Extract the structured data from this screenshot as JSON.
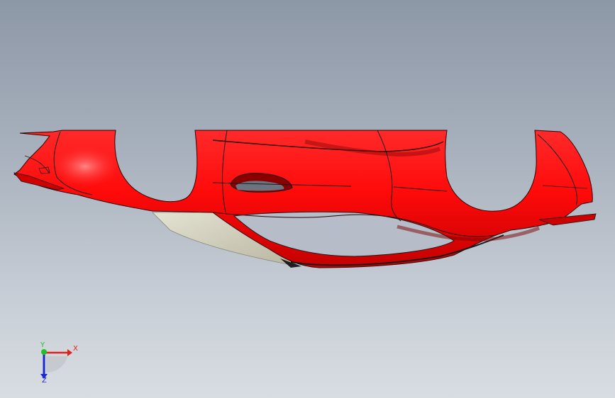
{
  "viewport": {
    "background_top": "#8d98a7",
    "background_bottom": "#d8dde2"
  },
  "model": {
    "body_color": "#ff0a0a",
    "body_shadow_color": "#c00000",
    "interior_color": "#d9d6c4",
    "edge_color": "#1a1a1a"
  },
  "triad": {
    "x_label": "X",
    "y_label": "Y",
    "z_label": "Z",
    "x_color": "#e0201a",
    "y_color": "#22c022",
    "z_color": "#1a2ad0"
  }
}
